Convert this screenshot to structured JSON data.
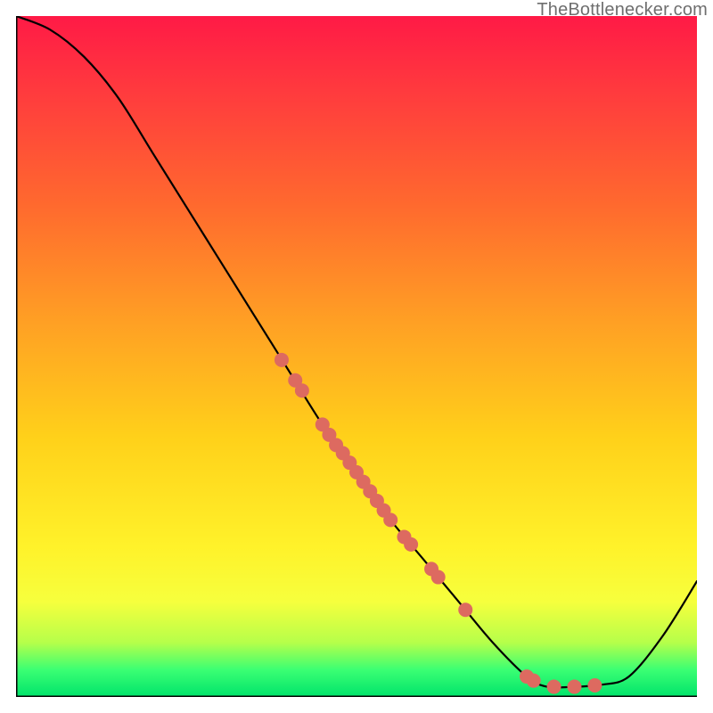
{
  "attribution": "TheBottlenecker.com",
  "chart_data": {
    "type": "line",
    "title": "",
    "xlabel": "",
    "ylabel": "",
    "x_range": [
      0,
      100
    ],
    "y_range": [
      0,
      100
    ],
    "curve_description": "Starts near top-left, descends steeply and nearly linearly to a flat minimum around x≈80, then rises toward the right edge.",
    "series": [
      {
        "name": "curve",
        "points": [
          {
            "x": 0,
            "y": 100
          },
          {
            "x": 5,
            "y": 98
          },
          {
            "x": 10,
            "y": 94
          },
          {
            "x": 15,
            "y": 88
          },
          {
            "x": 20,
            "y": 80
          },
          {
            "x": 25,
            "y": 72
          },
          {
            "x": 30,
            "y": 64
          },
          {
            "x": 35,
            "y": 56
          },
          {
            "x": 40,
            "y": 48
          },
          {
            "x": 45,
            "y": 40
          },
          {
            "x": 50,
            "y": 33
          },
          {
            "x": 55,
            "y": 26
          },
          {
            "x": 60,
            "y": 20
          },
          {
            "x": 65,
            "y": 14
          },
          {
            "x": 70,
            "y": 8
          },
          {
            "x": 75,
            "y": 3
          },
          {
            "x": 78,
            "y": 1.5
          },
          {
            "x": 82,
            "y": 1.5
          },
          {
            "x": 86,
            "y": 1.8
          },
          {
            "x": 90,
            "y": 3
          },
          {
            "x": 95,
            "y": 9
          },
          {
            "x": 100,
            "y": 17
          }
        ]
      }
    ],
    "markers": {
      "name": "highlighted-points",
      "color": "#dd6a60",
      "radius_px": 8,
      "points": [
        {
          "x": 39,
          "y": 49.5
        },
        {
          "x": 41,
          "y": 46.5
        },
        {
          "x": 42,
          "y": 45
        },
        {
          "x": 45,
          "y": 40
        },
        {
          "x": 46,
          "y": 38.5
        },
        {
          "x": 47,
          "y": 37
        },
        {
          "x": 48,
          "y": 35.8
        },
        {
          "x": 49,
          "y": 34.4
        },
        {
          "x": 50,
          "y": 33
        },
        {
          "x": 51,
          "y": 31.6
        },
        {
          "x": 52,
          "y": 30.2
        },
        {
          "x": 53,
          "y": 28.8
        },
        {
          "x": 54,
          "y": 27.4
        },
        {
          "x": 55,
          "y": 26
        },
        {
          "x": 57,
          "y": 23.5
        },
        {
          "x": 58,
          "y": 22.4
        },
        {
          "x": 61,
          "y": 18.8
        },
        {
          "x": 62,
          "y": 17.6
        },
        {
          "x": 66,
          "y": 12.8
        },
        {
          "x": 75,
          "y": 3
        },
        {
          "x": 76,
          "y": 2.4
        },
        {
          "x": 79,
          "y": 1.5
        },
        {
          "x": 82,
          "y": 1.5
        },
        {
          "x": 85,
          "y": 1.7
        }
      ]
    }
  }
}
